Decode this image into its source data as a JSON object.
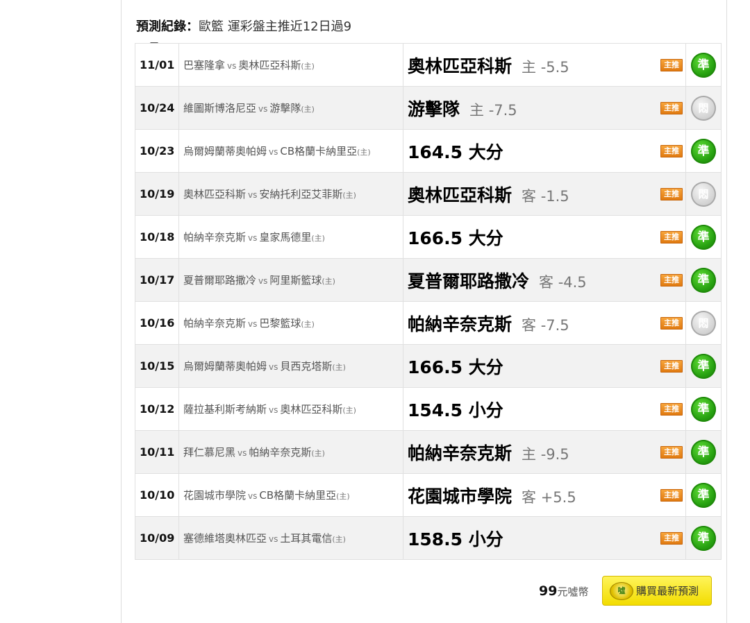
{
  "header": {
    "label": "預測紀錄：",
    "summary": "歐籃 運彩盤主推近12日過9"
  },
  "records": [
    {
      "date": "11/01",
      "home": "巴塞隆拿",
      "away": "奧林匹亞科斯",
      "marker": "(主)",
      "pick": "奧林匹亞科斯",
      "line": "主 -5.5",
      "tag": "主推",
      "result": "準",
      "hit": true
    },
    {
      "date": "10/24",
      "home": "維圖斯博洛尼亞",
      "away": "游擊隊",
      "marker": "(主)",
      "pick": "游擊隊",
      "line": "主 -7.5",
      "tag": "主推",
      "result": "悶",
      "hit": false
    },
    {
      "date": "10/23",
      "home": "烏爾姆蘭蒂奧帕姆",
      "away": "CB格蘭卡納里亞",
      "marker": "(主)",
      "pick": "164.5 大分",
      "line": "",
      "tag": "主推",
      "result": "準",
      "hit": true
    },
    {
      "date": "10/19",
      "home": "奧林匹亞科斯",
      "away": "安納托利亞艾菲斯",
      "marker": "(主)",
      "pick": "奧林匹亞科斯",
      "line": "客 -1.5",
      "tag": "主推",
      "result": "悶",
      "hit": false
    },
    {
      "date": "10/18",
      "home": "帕納辛奈克斯",
      "away": "皇家馬德里",
      "marker": "(主)",
      "pick": "166.5 大分",
      "line": "",
      "tag": "主推",
      "result": "準",
      "hit": true
    },
    {
      "date": "10/17",
      "home": "夏普爾耶路撒冷",
      "away": "阿里斯籃球",
      "marker": "(主)",
      "pick": "夏普爾耶路撒冷",
      "line": "客 -4.5",
      "tag": "主推",
      "result": "準",
      "hit": true
    },
    {
      "date": "10/16",
      "home": "帕納辛奈克斯",
      "away": "巴黎籃球",
      "marker": "(主)",
      "pick": "帕納辛奈克斯",
      "line": "客 -7.5",
      "tag": "主推",
      "result": "悶",
      "hit": false
    },
    {
      "date": "10/15",
      "home": "烏爾姆蘭蒂奧帕姆",
      "away": "貝西克塔斯",
      "marker": "(主)",
      "pick": "166.5 大分",
      "line": "",
      "tag": "主推",
      "result": "準",
      "hit": true
    },
    {
      "date": "10/12",
      "home": "薩拉基利斯考納斯",
      "away": "奧林匹亞科斯",
      "marker": "(主)",
      "pick": "154.5 小分",
      "line": "",
      "tag": "主推",
      "result": "準",
      "hit": true
    },
    {
      "date": "10/11",
      "home": "拜仁慕尼黑",
      "away": "帕納辛奈克斯",
      "marker": "(主)",
      "pick": "帕納辛奈克斯",
      "line": "主 -9.5",
      "tag": "主推",
      "result": "準",
      "hit": true
    },
    {
      "date": "10/10",
      "home": "花園城市學院",
      "away": "CB格蘭卡納里亞",
      "marker": "(主)",
      "pick": "花園城市學院",
      "line": "客 +5.5",
      "tag": "主推",
      "result": "準",
      "hit": true
    },
    {
      "date": "10/09",
      "home": "塞德維塔奧林匹亞",
      "away": "土耳其電信",
      "marker": "(主)",
      "pick": "158.5 小分",
      "line": "",
      "tag": "主推",
      "result": "準",
      "hit": true
    }
  ],
  "vs_label": "vs",
  "footer": {
    "price": "99",
    "unit": "元噓幣",
    "coin_text": "噓",
    "buy_label": "購買最新預測"
  }
}
